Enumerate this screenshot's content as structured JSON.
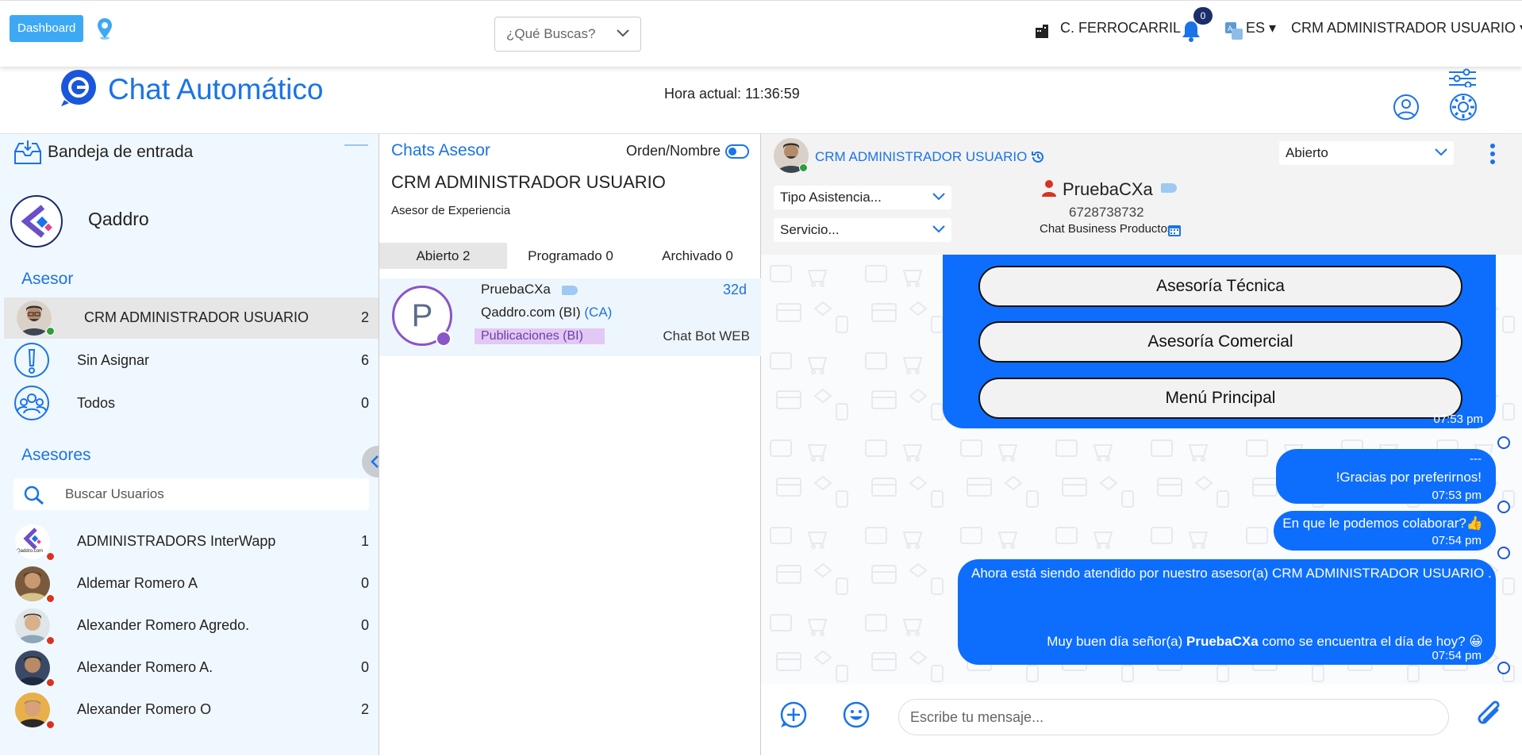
{
  "topbar": {
    "dashboard_label": "Dashboard",
    "search_placeholder": "¿Qué Buscas?",
    "branch": "C. FERROCARRIL",
    "notifications_count": "0",
    "language": "ES",
    "user": "CRM ADMINISTRADOR USUARIO"
  },
  "header": {
    "title": "Chat Automático",
    "clock": "Hora actual: 11:36:59"
  },
  "inbox": {
    "title": "Bandeja de entrada",
    "company": "Qaddro",
    "asesor_heading": "Asesor",
    "filters": [
      {
        "label": "CRM ADMINISTRADOR USUARIO",
        "count": "2"
      },
      {
        "label": "Sin Asignar",
        "count": "6"
      },
      {
        "label": "Todos",
        "count": "0"
      }
    ],
    "asesores_heading": "Asesores",
    "search_placeholder": "Buscar Usuarios",
    "advisors": [
      {
        "name": "ADMINISTRADORS InterWapp",
        "count": "1",
        "avatar_text": "Qaddro.com"
      },
      {
        "name": "Aldemar Romero A",
        "count": "0"
      },
      {
        "name": "Alexander Romero Agredo.",
        "count": "0"
      },
      {
        "name": "Alexander Romero A.",
        "count": "0"
      },
      {
        "name": "Alexander Romero O",
        "count": "2"
      }
    ]
  },
  "chats": {
    "title": "Chats Asesor",
    "order_label": "Orden/Nombre",
    "advisor_name": "CRM ADMINISTRADOR USUARIO",
    "advisor_role": "Asesor de Experiencia",
    "tabs": [
      "Abierto 2",
      "Programado 0",
      "Archivado 0"
    ],
    "item": {
      "initial": "P",
      "name": "PruebaCXa",
      "age": "32d",
      "company": "Qaddro.com (BI)",
      "company_tag": "(CA)",
      "label": "Publicaciones (BI)",
      "channel": "Chat Bot WEB"
    }
  },
  "conversation": {
    "agent": "CRM ADMINISTRADOR USUARIO",
    "status": "Abierto",
    "tipo_asistencia": "Tipo Asistencia...",
    "servicio": "Servicio...",
    "contact_name": "PruebaCXa",
    "contact_phone": "6728738732",
    "contact_channel": "Chat Business Productos",
    "options": [
      "Asesoría Técnica",
      "Asesoría Comercial",
      "Menú Principal"
    ],
    "messages": [
      {
        "time": "07:53 pm"
      },
      {
        "lines": [
          "---",
          "!Gracias por preferirnos!"
        ],
        "time": "07:53 pm"
      },
      {
        "text": "En que le podemos colaborar?👍",
        "time": "07:54 pm"
      },
      {
        "text1": "Ahora está siendo atendido por nuestro asesor(a) CRM ADMINISTRADOR USUARIO .",
        "text2a": "Muy buen día señor(a) ",
        "text2b": "PruebaCXa",
        "text2c": " como se encuentra el día de hoy? 😀",
        "time": "07:54 pm"
      }
    ],
    "composer_placeholder": "Escribe tu mensaje..."
  },
  "colors": {
    "primary": "#1a73e8",
    "bubble": "#0d6efd",
    "online": "#2e9e3e",
    "offline": "#d9331f"
  }
}
